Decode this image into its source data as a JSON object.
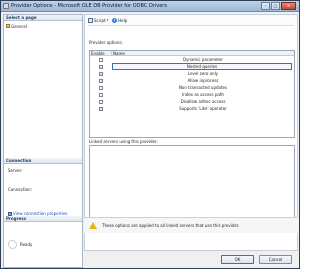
{
  "window": {
    "title": "Provider Options - Microsoft OLE DB Provider for ODBC Drivers",
    "buttons": {
      "minimize": "–",
      "maximize": "□",
      "close": "✕"
    }
  },
  "sidebar": {
    "select_page_header": "Select a page",
    "pages": [
      {
        "label": "General",
        "icon": "page-icon"
      }
    ],
    "connection_header": "Connection",
    "server_label": "Server:",
    "connection_label": "Connection:",
    "view_connection_link": "View connection properties",
    "progress_header": "Progress",
    "progress_status": "Ready"
  },
  "toolbar": {
    "script_label": "Script",
    "help_label": "Help"
  },
  "provider_options": {
    "label": "Provider options:",
    "columns": [
      "Enable",
      "Name"
    ],
    "rows": [
      {
        "name": "Dynamic parameter",
        "checked": false
      },
      {
        "name": "Nested queries",
        "checked": true,
        "selected": true
      },
      {
        "name": "Level zero only",
        "checked": true
      },
      {
        "name": "Allow inprocess",
        "checked": true
      },
      {
        "name": "Non transacted updates",
        "checked": false
      },
      {
        "name": "Index as access path",
        "checked": false
      },
      {
        "name": "Disallow adhoc access",
        "checked": false
      },
      {
        "name": "Supports 'Like' operator",
        "checked": true
      }
    ]
  },
  "linked_servers": {
    "label": "Linked servers using this provider:"
  },
  "warning": {
    "text": "These options are applied to all linked servers that use this provider."
  },
  "footer": {
    "ok_label": "OK",
    "cancel_label": "Cancel"
  }
}
